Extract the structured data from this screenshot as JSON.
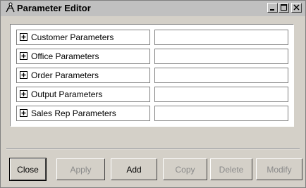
{
  "window": {
    "title": "Parameter Editor",
    "title_icon": "compass-icon",
    "controls": [
      "minimize-icon",
      "maximize-icon",
      "close-icon"
    ]
  },
  "parameters": {
    "rows": [
      {
        "label": "Customer Parameters",
        "value": "",
        "expander_icon": "plus-icon"
      },
      {
        "label": "Office Parameters",
        "value": "",
        "expander_icon": "plus-icon"
      },
      {
        "label": "Order Parameters",
        "value": "",
        "expander_icon": "plus-icon"
      },
      {
        "label": "Output Parameters",
        "value": "",
        "expander_icon": "plus-icon"
      },
      {
        "label": "Sales Rep Parameters",
        "value": "",
        "expander_icon": "plus-icon"
      }
    ]
  },
  "buttons": {
    "close": {
      "label": "Close",
      "enabled": true
    },
    "apply": {
      "label": "Apply",
      "enabled": false
    },
    "add": {
      "label": "Add",
      "enabled": true
    },
    "copy": {
      "label": "Copy",
      "enabled": false
    },
    "delete": {
      "label": "Delete",
      "enabled": false
    },
    "modify": {
      "label": "Modify",
      "enabled": false
    }
  },
  "colors": {
    "window_bg": "#d4d0c8",
    "titlebar_bg": "#c0c0c0",
    "disabled_text": "#8a8a8a"
  }
}
